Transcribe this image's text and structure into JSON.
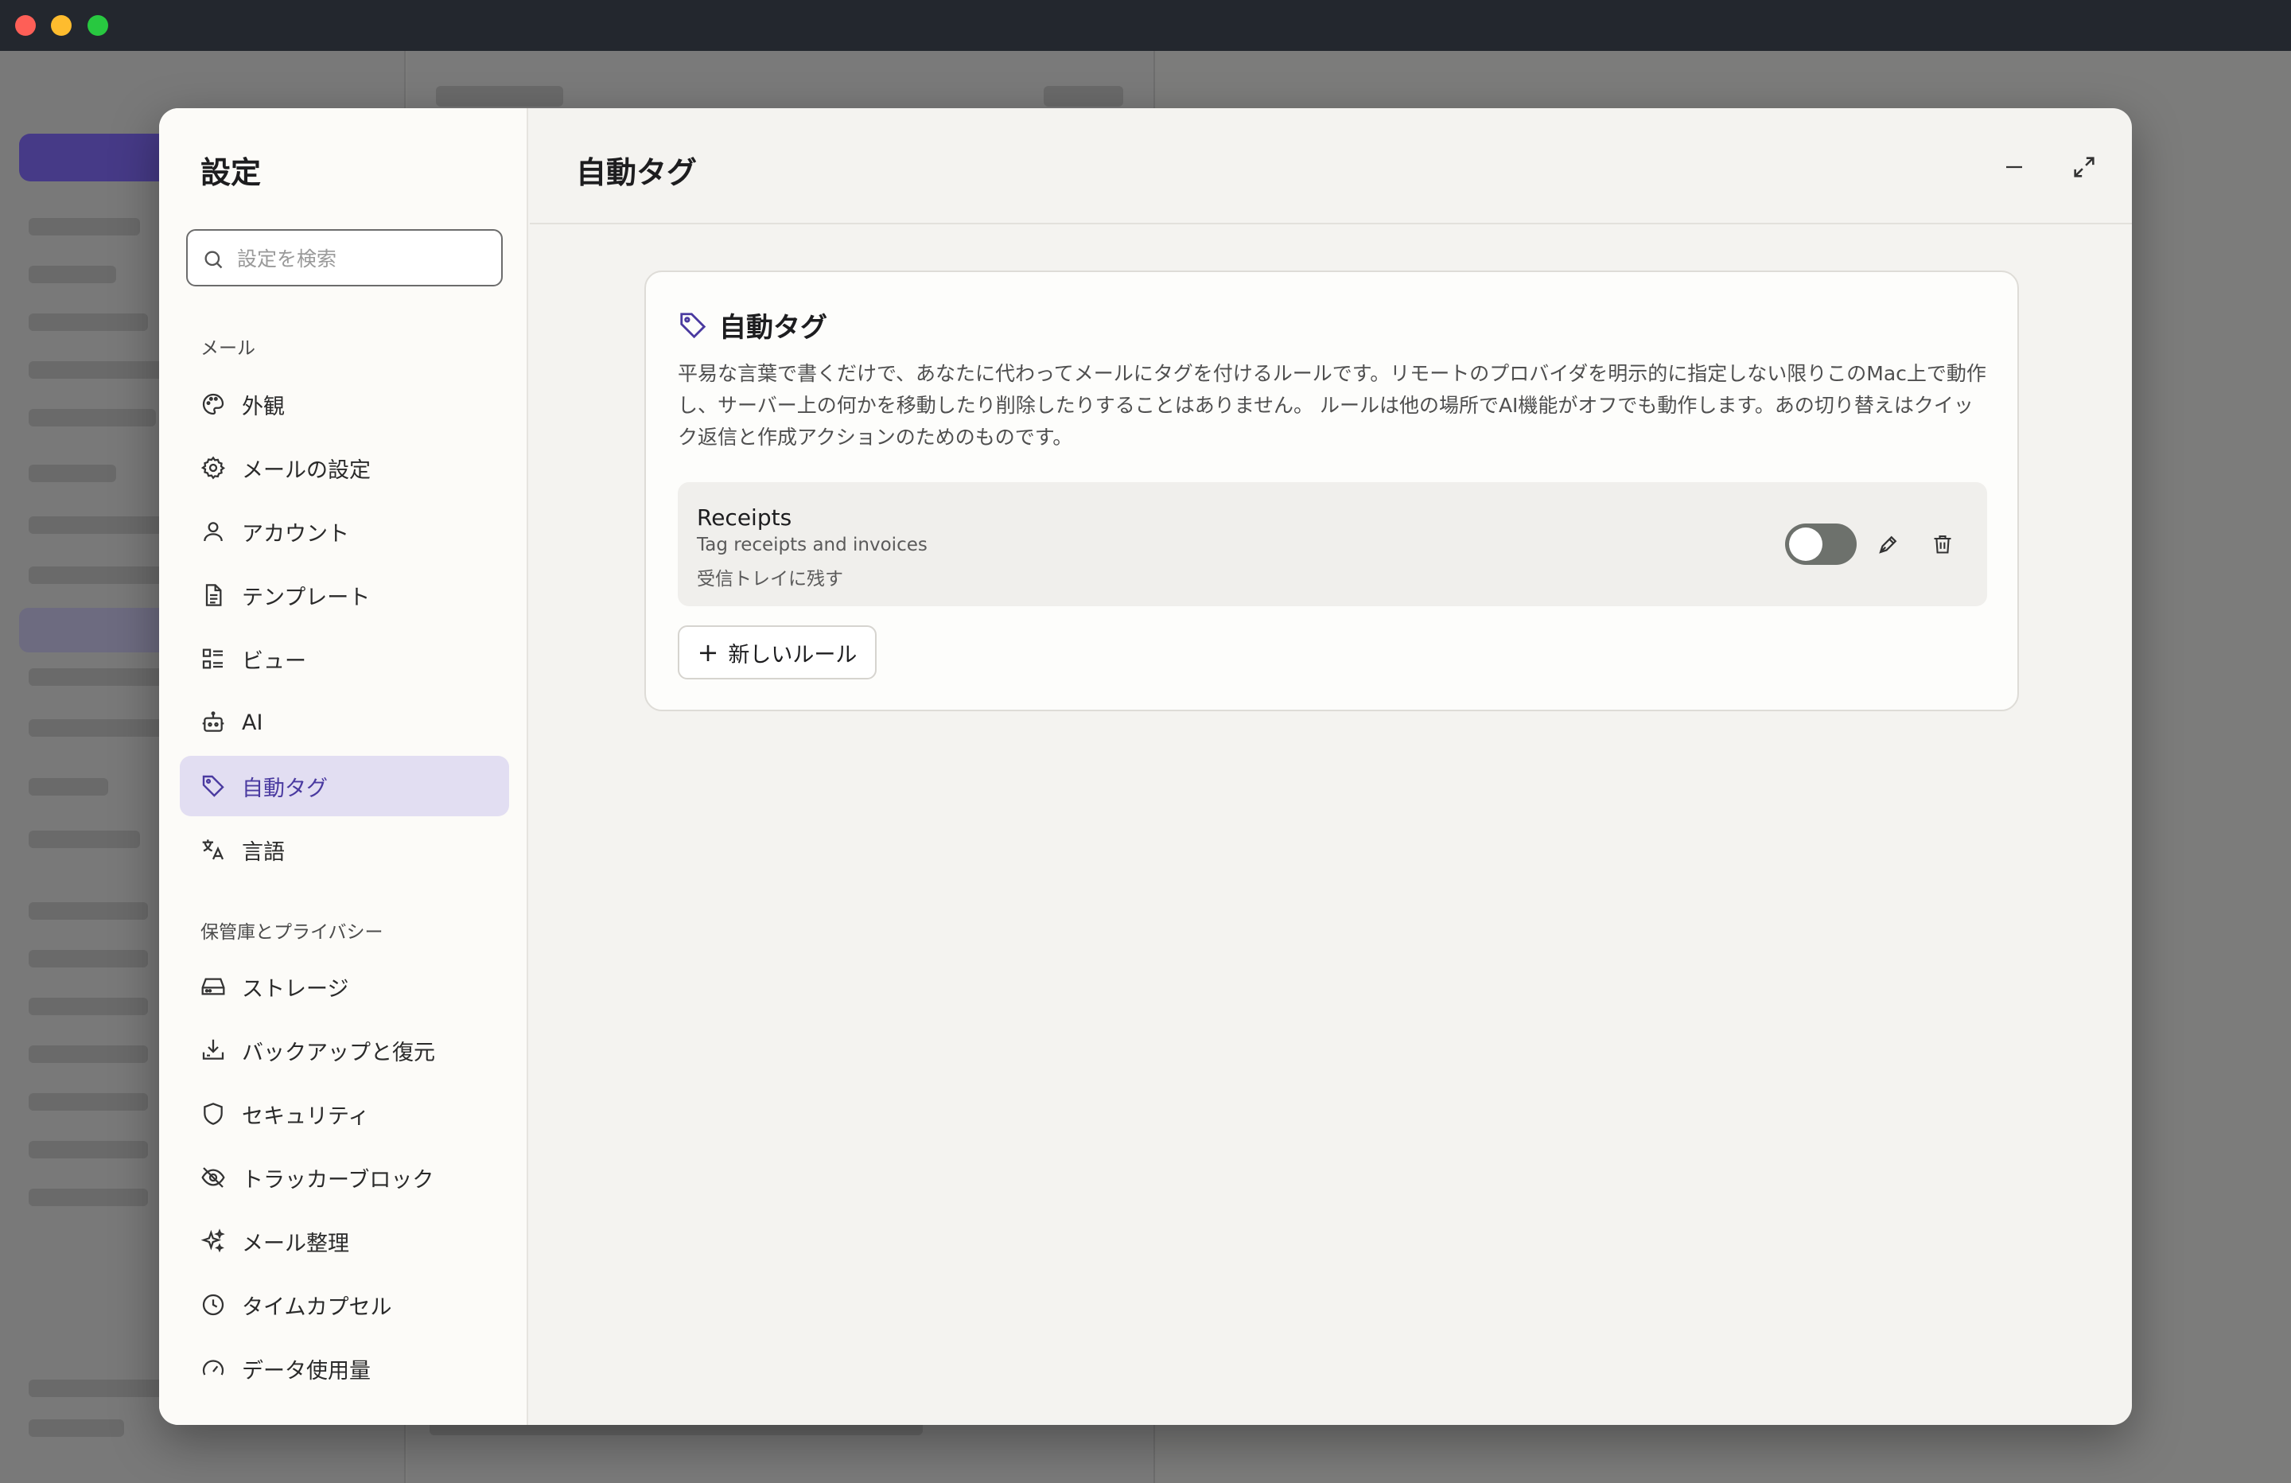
{
  "window": {
    "controls": [
      "close",
      "minimize",
      "maximize"
    ]
  },
  "sidebar": {
    "title": "設定",
    "search_placeholder": "設定を検索",
    "section_mail": "メール",
    "section_vault": "保管庫とプライバシー",
    "items_mail": [
      {
        "label": "外観",
        "icon": "palette-icon"
      },
      {
        "label": "メールの設定",
        "icon": "gear-icon"
      },
      {
        "label": "アカウント",
        "icon": "user-icon"
      },
      {
        "label": "テンプレート",
        "icon": "document-icon"
      },
      {
        "label": "ビュー",
        "icon": "view-list-icon"
      },
      {
        "label": "AI",
        "icon": "robot-icon"
      },
      {
        "label": "自動タグ",
        "icon": "tag-icon",
        "active": true
      },
      {
        "label": "言語",
        "icon": "translate-icon"
      }
    ],
    "items_vault": [
      {
        "label": "ストレージ",
        "icon": "drive-icon"
      },
      {
        "label": "バックアップと復元",
        "icon": "download-icon"
      },
      {
        "label": "セキュリティ",
        "icon": "shield-icon"
      },
      {
        "label": "トラッカーブロック",
        "icon": "eye-off-icon"
      },
      {
        "label": "メール整理",
        "icon": "sparkles-icon"
      },
      {
        "label": "タイムカプセル",
        "icon": "clock-icon"
      },
      {
        "label": "データ使用量",
        "icon": "gauge-icon"
      }
    ]
  },
  "main": {
    "title": "自動タグ",
    "card": {
      "title": "自動タグ",
      "description": "平易な言葉で書くだけで、あなたに代わってメールにタグを付けるルールです。リモートのプロバイダを明示的に指定しない限りこのMac上で動作し、サーバー上の何かを移動したり削除したりすることはありません。 ルールは他の場所でAI機能がオフでも動作します。あの切り替えはクイック返信と作成アクションのためのものです。",
      "rules": [
        {
          "name": "Receipts",
          "description": "Tag receipts and invoices",
          "action": "受信トレイに残す",
          "enabled": false
        }
      ],
      "new_rule_label": "新しいルール"
    }
  },
  "colors": {
    "accent": "#4a3aa0",
    "active_bg": "#e2def2",
    "toggle_off": "#6d716c"
  }
}
